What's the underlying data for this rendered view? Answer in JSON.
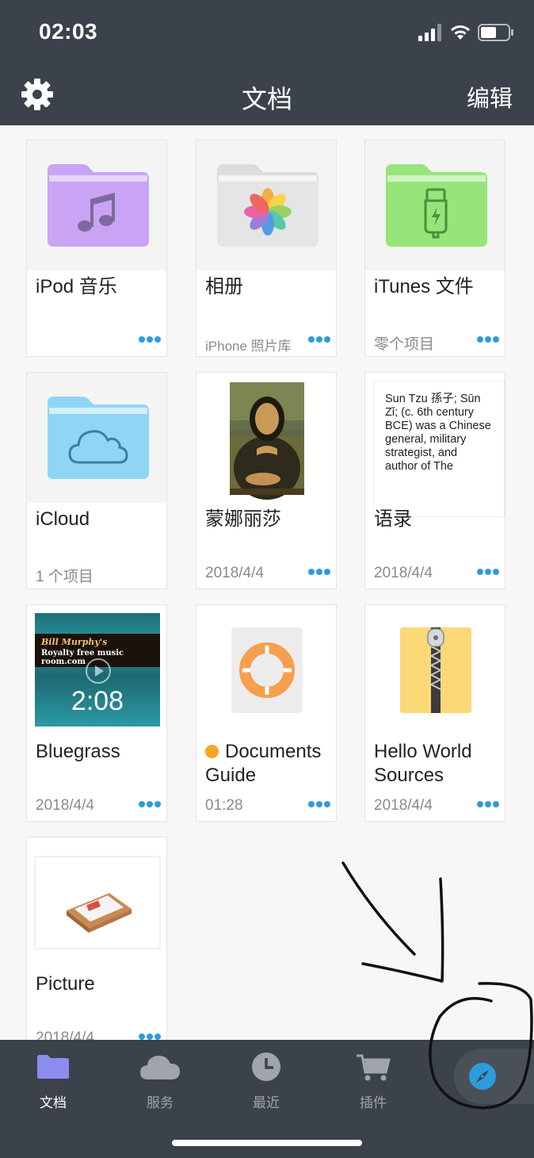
{
  "status_bar": {
    "time": "02:03"
  },
  "nav": {
    "title": "文档",
    "edit_label": "编辑"
  },
  "files": [
    {
      "name": "iPod 音乐",
      "subtitle": "",
      "thumb": "music-folder-icon",
      "folder_color": "#c9a4f4",
      "has_more": true
    },
    {
      "name": "相册",
      "subtitle": "iPhone 照片库",
      "thumb": "photos-folder-icon",
      "folder_color": "#e5e5e5",
      "has_more": true
    },
    {
      "name": "iTunes 文件",
      "subtitle": "零个项目",
      "thumb": "usb-folder-icon",
      "folder_color": "#97e57a",
      "has_more": true
    },
    {
      "name": "iCloud",
      "subtitle": "1 个项目",
      "thumb": "cloud-folder-icon",
      "folder_color": "#8fd6f5",
      "has_more": false
    },
    {
      "name": "蒙娜丽莎",
      "subtitle": "2018/4/4",
      "thumb": "painting-image",
      "has_more": true
    },
    {
      "name": "语录",
      "subtitle": "2018/4/4",
      "thumb": "text-document",
      "preview_text": "Sun Tzu 孫子; Sūn Zǐ; (c. 6th century BCE) was a Chinese general, military strategist, and author of The",
      "has_more": true
    },
    {
      "name": "Bluegrass",
      "subtitle": "2018/4/4",
      "thumb": "video-thumbnail",
      "video_duration": "2:08",
      "video_caption_1": "Bill Murphy's",
      "video_caption_2": "Royalty free music room.com",
      "has_more": true
    },
    {
      "name": "Documents Guide",
      "subtitle": "01:28",
      "thumb": "lifebuoy-icon",
      "unread_dot": true,
      "has_more": true
    },
    {
      "name": "Hello World Sources",
      "subtitle": "2018/4/4",
      "thumb": "zip-archive-icon",
      "has_more": true
    },
    {
      "name": "Picture",
      "subtitle": "2018/4/4",
      "thumb": "picture-tray-image",
      "has_more": true
    }
  ],
  "tabs": [
    {
      "label": "文档",
      "icon": "folder-icon",
      "active": true
    },
    {
      "label": "服务",
      "icon": "cloud-icon",
      "active": false
    },
    {
      "label": "最近",
      "icon": "clock-icon",
      "active": false
    },
    {
      "label": "插件",
      "icon": "cart-icon",
      "active": false
    }
  ],
  "colors": {
    "bar": "#3c424b",
    "accent_blue": "#2d9cdb",
    "active_folder": "#8c8cf0"
  }
}
